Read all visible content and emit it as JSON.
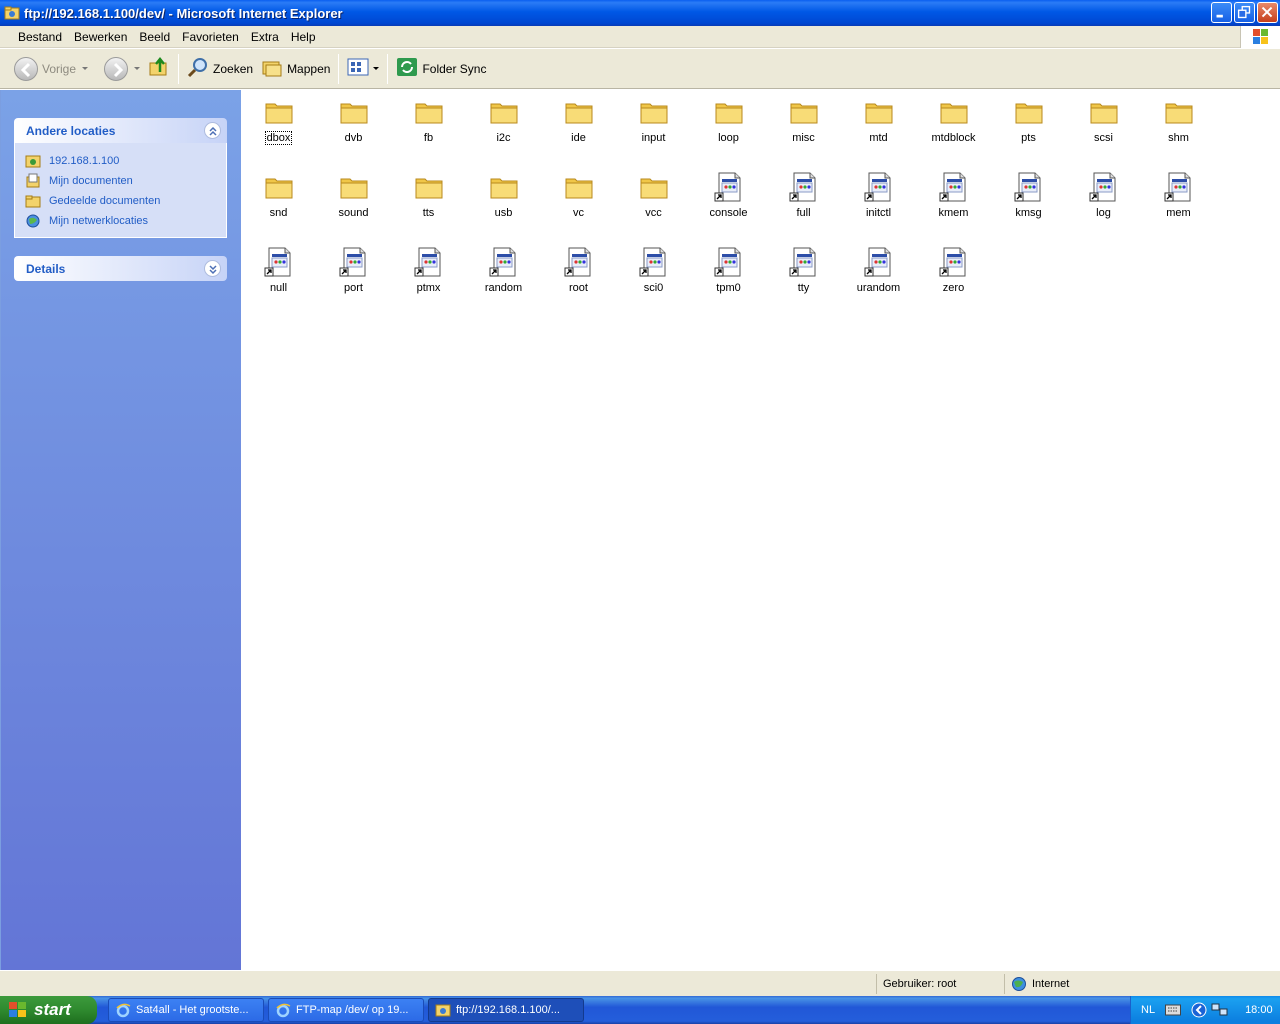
{
  "window": {
    "title": "ftp://192.168.1.100/dev/ - Microsoft Internet Explorer"
  },
  "menu": [
    "Bestand",
    "Bewerken",
    "Beeld",
    "Favorieten",
    "Extra",
    "Help"
  ],
  "toolbar": {
    "back_label": "Vorige",
    "search_label": "Zoeken",
    "folders_label": "Mappen",
    "sync_label": "Folder Sync"
  },
  "sidebar": {
    "other_places": {
      "title": "Andere locaties",
      "links": [
        "192.168.1.100",
        "Mijn documenten",
        "Gedeelde documenten",
        "Mijn netwerklocaties"
      ]
    },
    "details": {
      "title": "Details"
    }
  },
  "content": {
    "folders": [
      "dbox",
      "dvb",
      "fb",
      "i2c",
      "ide",
      "input",
      "loop",
      "misc",
      "mtd",
      "mtdblock",
      "pts",
      "scsi",
      "shm",
      "snd",
      "sound",
      "tts",
      "usb",
      "vc",
      "vcc"
    ],
    "files": [
      "console",
      "full",
      "initctl",
      "kmem",
      "kmsg",
      "log",
      "mem",
      "null",
      "port",
      "ptmx",
      "random",
      "root",
      "sci0",
      "tpm0",
      "tty",
      "urandom",
      "zero"
    ]
  },
  "statusbar": {
    "user": "Gebruiker: root",
    "zone": "Internet"
  },
  "taskbar": {
    "start_label": "start",
    "tasks": [
      "Sat4all - Het grootste...",
      "FTP-map /dev/ op 19...",
      "ftp://192.168.1.100/..."
    ],
    "language": "NL",
    "clock": "18:00"
  }
}
